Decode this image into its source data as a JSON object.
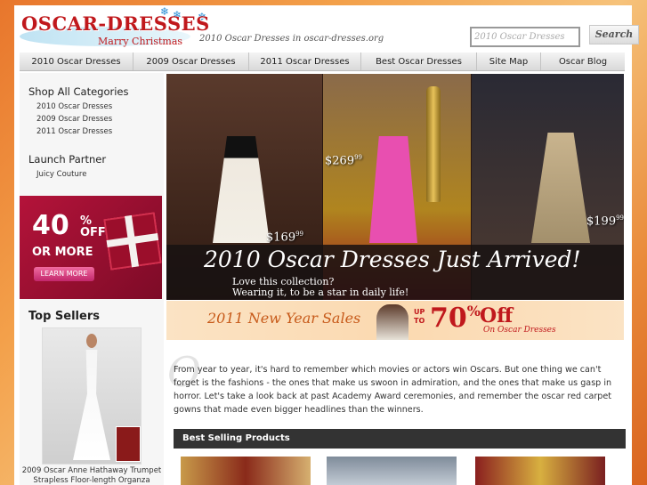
{
  "header": {
    "brand": "OSCAR-DRESSES",
    "brand_sub": "Marry Christmas",
    "tagline": "2010 Oscar Dresses in oscar-dresses.org",
    "search": {
      "placeholder": "2010 Oscar Dresses",
      "button_label": "Search"
    }
  },
  "nav": [
    "2010 Oscar Dresses",
    "2009 Oscar Dresses",
    "2011 Oscar Dresses",
    "Best Oscar Dresses",
    "Site Map",
    "Oscar Blog"
  ],
  "sidebar": {
    "categories_heading": "Shop All Categories",
    "categories": [
      "2010 Oscar Dresses",
      "2009 Oscar Dresses",
      "2011 Oscar Dresses"
    ],
    "partner_heading": "Launch Partner",
    "partner_link": "Juicy Couture",
    "promo": {
      "percent": "40",
      "pct_sign": "%",
      "off": "OFF",
      "or_more": "OR MORE",
      "button": "LEARN MORE"
    },
    "top_sellers_heading": "Top Sellers",
    "top_seller_caption": "2009 Oscar Anne Hathaway Trumpet Strapless Floor-length Organza Evening Dress"
  },
  "hero": {
    "prices": [
      "$169",
      "$269",
      "$199"
    ],
    "price_cents": "99",
    "headline": "2010 Oscar Dresses Just Arrived!",
    "sub_line1": "Love this collection?",
    "sub_line2": "Wearing it, to be a star in daily life!"
  },
  "sale_banner": {
    "title": "2011 New Year Sales",
    "up": "UP",
    "to": "TO",
    "percent": "70",
    "pct_sign": "%",
    "off": "Off",
    "on": "On Oscar Dresses"
  },
  "intro": {
    "initial": "O",
    "text": "From year to year, it's hard to remember which movies or actors win Oscars. But one thing we can't forget is the fashions - the ones that make us swoon in admiration, and the ones that make us gasp in horror. Let's take a look back at past Academy Award ceremonies, and remember the oscar red carpet gowns that made even bigger headlines than the winners."
  },
  "best_selling": {
    "heading": "Best Selling Products"
  }
}
